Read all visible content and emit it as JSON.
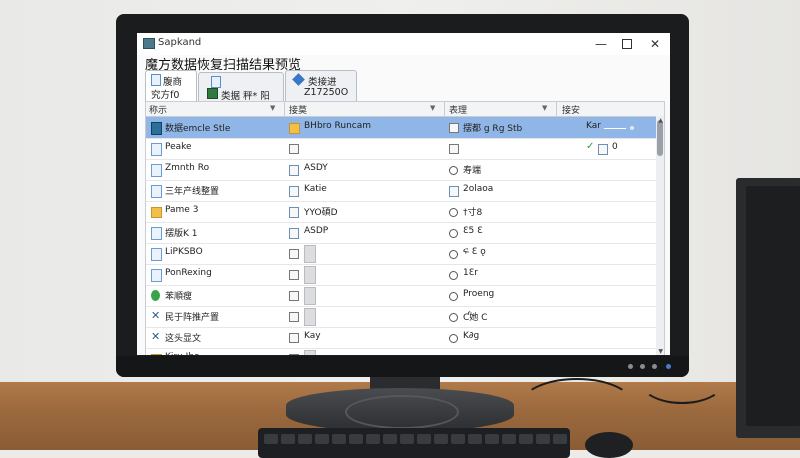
{
  "window": {
    "title": "Sapkand",
    "heading": "魔方数据恢复扫描结果预览"
  },
  "tabs": [
    {
      "line1": "腹商",
      "line2": "究方f0"
    },
    {
      "line1": "",
      "line2": "类据 秤* 阳"
    },
    {
      "line1": "类接进",
      "line2": "Z17250O"
    }
  ],
  "columns": [
    "称示",
    "接莫",
    "表理",
    "接安"
  ],
  "rows": [
    {
      "name": "数据emcle Stle",
      "name_icon": "grid-icon",
      "col2": "BHbro Runcam",
      "col2_icon": "folder-icon",
      "col3": "摆都 g Rg Stb",
      "col3_icon": "box-icon",
      "col4": "Kar",
      "selected": true
    },
    {
      "name": "Peake",
      "name_icon": "document-icon",
      "col2": "",
      "col2_icon": "checkbox-icon",
      "col3": "",
      "col3_icon": "box-icon",
      "col4": "0",
      "selected": false
    },
    {
      "name": "Zmnth Ro",
      "name_icon": "document-icon",
      "col2": "ASDY",
      "col2_icon": "upload-icon",
      "col3": "寿端",
      "col3_icon": "circle-icon",
      "col4": "",
      "selected": false
    },
    {
      "name": "三年产线整置",
      "name_icon": "document-icon",
      "col2": "Katie",
      "col2_icon": "image-icon",
      "col3": "2olaoa",
      "col3_icon": "doc-icon",
      "col4": "",
      "selected": false
    },
    {
      "name": "Pame 3",
      "name_icon": "folder-icon",
      "col2": "YYO碩D",
      "col2_icon": "upload-icon",
      "col3": "†寸8",
      "col3_icon": "settings-icon",
      "col4": "",
      "selected": false
    },
    {
      "name": "摆版K 1",
      "name_icon": "document-icon",
      "col2": "ASDP",
      "col2_icon": "upload-icon",
      "col3": "Ɛ5 Ɛ",
      "col3_icon": "settings-icon",
      "col4": "",
      "selected": false
    },
    {
      "name": "LiPKSBO",
      "name_icon": "document-icon",
      "col2": "",
      "col2_icon": "plus-box-icon",
      "col3": "ፍ Ɛ ǫ",
      "col3_icon": "settings-icon",
      "col4": "",
      "selected": false
    },
    {
      "name": "PonRexing",
      "name_icon": "document-icon",
      "col2": "",
      "col2_icon": "grid-box-icon",
      "col3": "1Ɛr",
      "col3_icon": "settings-icon",
      "col4": "",
      "selected": false
    },
    {
      "name": "苯順瘦",
      "name_icon": "leaf-icon",
      "col2": "",
      "col2_icon": "window-icon",
      "col3": "Proeng",
      "col3_icon": "circle-icon",
      "col4": "",
      "selected": false
    },
    {
      "name": "民于阵推产置",
      "name_icon": "cross-icon",
      "col2": "",
      "col2_icon": "box-icon",
      "col3": "Ƈ她 C",
      "col3_icon": "diamond-icon",
      "col4": "",
      "selected": false
    },
    {
      "name": "这头显文",
      "name_icon": "cross-icon",
      "col2": "Kay",
      "col2_icon": "box-icon",
      "col3": "K∂g",
      "col3_icon": "settings-icon",
      "col4": "",
      "selected": false
    },
    {
      "name": "Kiru Ibo",
      "name_icon": "folder-icon",
      "col2": "",
      "col2_icon": "box-icon",
      "col3": "",
      "col3_icon": "settings-icon",
      "col4": "",
      "selected": false
    }
  ],
  "colors": {
    "selection": "#8fb6e6",
    "folder": "#f2c04a",
    "bezel": "#1b1c1e"
  }
}
